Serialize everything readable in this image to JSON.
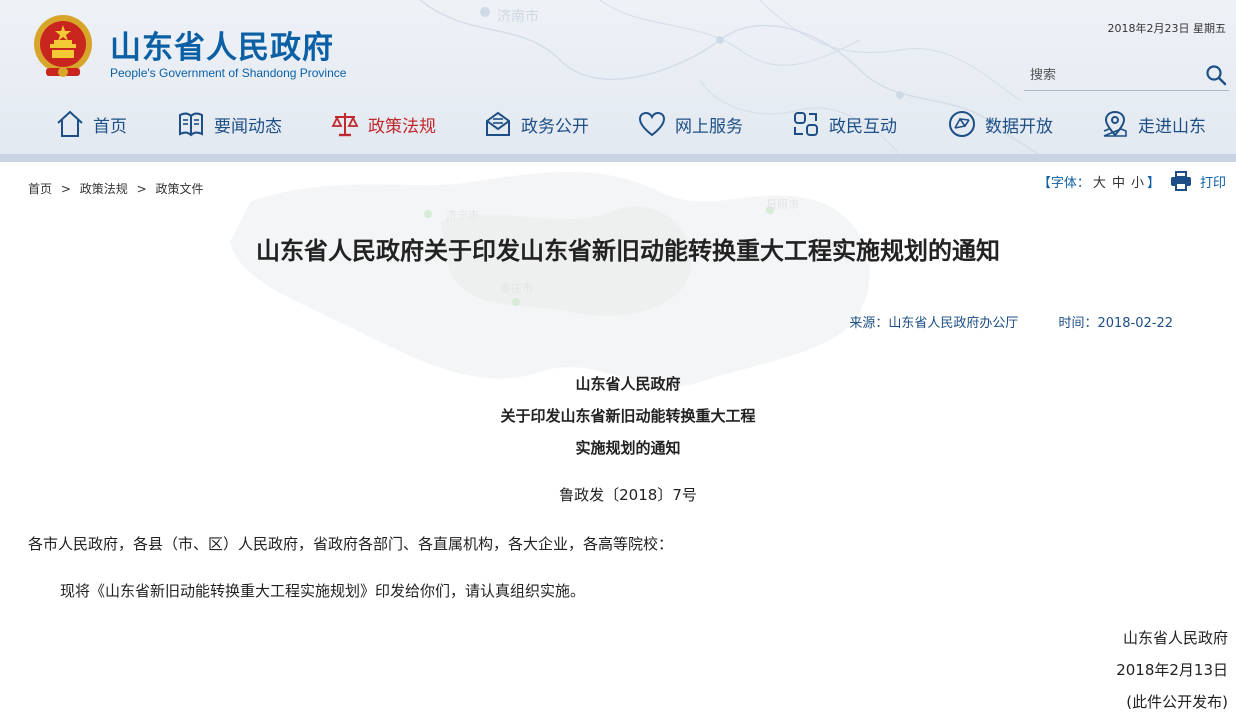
{
  "header": {
    "title": "山东省人民政府",
    "subtitle": "People's Government of Shandong Province",
    "date": "2018年2月23日 星期五",
    "map_labels": [
      "济南市"
    ],
    "search": {
      "placeholder": "搜索"
    }
  },
  "nav": [
    {
      "label": "首页",
      "icon": "home-icon"
    },
    {
      "label": "要闻动态",
      "icon": "newspaper-icon"
    },
    {
      "label": "政策法规",
      "icon": "scales-icon",
      "active": true
    },
    {
      "label": "政务公开",
      "icon": "mail-open-icon"
    },
    {
      "label": "网上服务",
      "icon": "heart-icon"
    },
    {
      "label": "政民互动",
      "icon": "interaction-icon"
    },
    {
      "label": "数据开放",
      "icon": "data-network-icon"
    },
    {
      "label": "走进山东",
      "icon": "map-pin-icon"
    }
  ],
  "breadcrumb": [
    "首页",
    "政策法规",
    "政策文件"
  ],
  "breadcrumb_sep": ">",
  "tools": {
    "font_label_open": "【字体：",
    "sizes": [
      "大",
      "中",
      "小"
    ],
    "font_label_close": "】",
    "print": "打印"
  },
  "bg_map_labels": [
    "济宁市",
    "日照市",
    "枣庄市"
  ],
  "article": {
    "title": "山东省人民政府关于印发山东省新旧动能转换重大工程实施规划的通知",
    "source": "来源：山东省人民政府办公厅",
    "time": "时间：2018-02-22",
    "heading_lines": [
      "山东省人民政府",
      "关于印发山东省新旧动能转换重大工程",
      "实施规划的通知"
    ],
    "doc_number": "鲁政发〔2018〕7号",
    "recipients": "各市人民政府，各县（市、区）人民政府，省政府各部门、各直属机构，各大企业，各高等院校：",
    "body": "现将《山东省新旧动能转换重大工程实施规划》印发给你们，请认真组织实施。",
    "signature": "山东省人民政府",
    "sign_date": "2018年2月13日",
    "note": "(此件公开发布)"
  },
  "colors": {
    "brand_blue": "#0b5fa5",
    "nav_blue": "#1d4f86",
    "active_red": "#c0282c"
  }
}
